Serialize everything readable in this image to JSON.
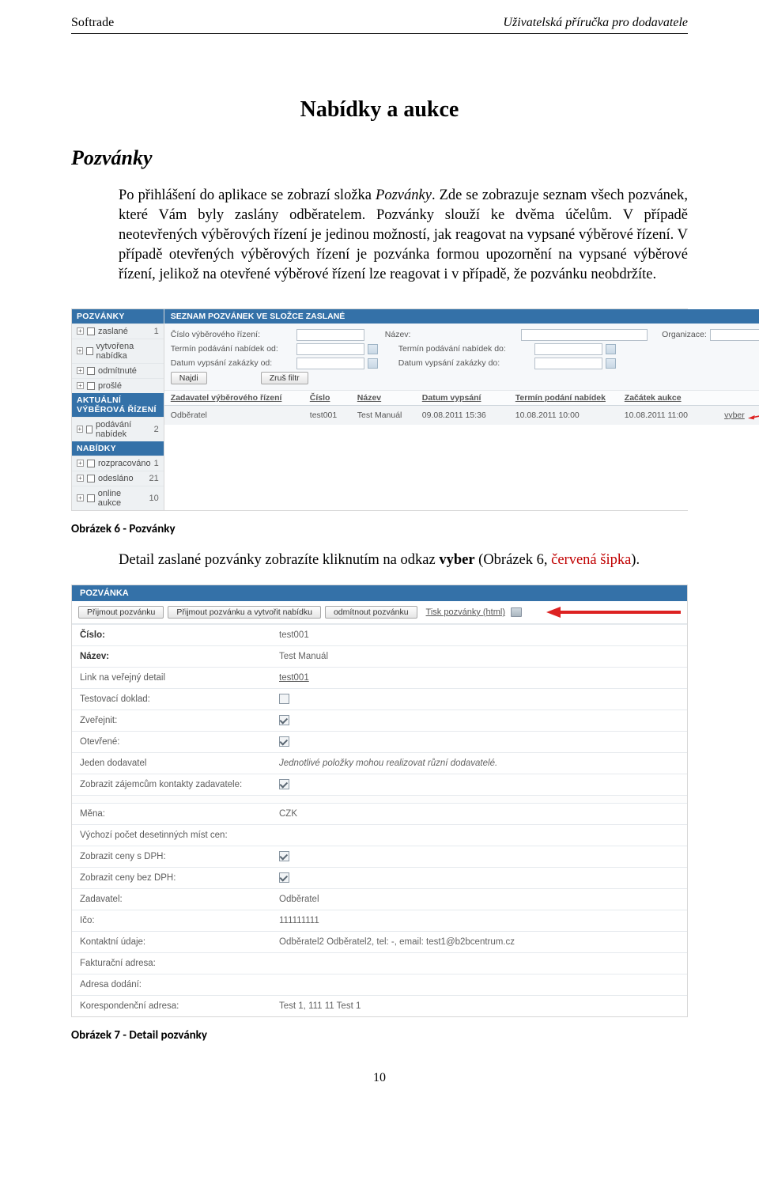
{
  "header": {
    "left": "Softrade",
    "right": "Uživatelská příručka pro dodavatele"
  },
  "h1": "Nabídky a aukce",
  "h2": "Pozvánky",
  "para1_parts": {
    "a": "Po přihlášení do aplikace se zobrazí složka ",
    "b": "Pozvánky",
    "c": ". Zde se zobrazuje seznam všech pozvánek, které Vám byly zaslány odběratelem. Pozvánky slouží ke dvěma účelům. V případě neotevřených výběrových řízení je jedinou možností, jak reagovat na vypsané výběrové řízení. V případě otevřených výběrových řízení je pozvánka formou upozornění na vypsané výběrové řízení, jelikož na otevřené výběrové řízení lze reagovat i v případě, že pozvánku neobdržíte."
  },
  "caption1": "Obrázek 6 - Pozvánky",
  "para2_parts": {
    "a": "Detail zaslané pozvánky zobrazíte kliknutím na odkaz ",
    "b": "vyber",
    "c": " (Obrázek 6, ",
    "d": "červená šipka",
    "e": ")."
  },
  "caption2": "Obrázek 7 - Detail pozvánky",
  "page_num": "10",
  "shot1": {
    "side": {
      "sec1": "POZVÁNKY",
      "items1": [
        {
          "label": "zaslané",
          "count": "1"
        },
        {
          "label": "vytvořena nabídka",
          "count": ""
        },
        {
          "label": "odmítnuté",
          "count": ""
        },
        {
          "label": "prošlé",
          "count": ""
        }
      ],
      "sec2": "AKTUÁLNÍ VÝBĚROVÁ ŘÍZENÍ",
      "items2": [
        {
          "label": "podávání nabídek",
          "count": "2"
        }
      ],
      "sec3": "NABÍDKY",
      "items3": [
        {
          "label": "rozpracováno",
          "count": "1"
        },
        {
          "label": "odesláno",
          "count": "21"
        },
        {
          "label": "online aukce",
          "count": "10"
        }
      ]
    },
    "main": {
      "sec": "SEZNAM POZVÁNEK VE SLOŽCE ZASLANÉ",
      "filter": {
        "r1": {
          "l1": "Číslo výběrového řízení:",
          "l2": "Název:",
          "l3": "Organizace:"
        },
        "r2": {
          "l1": "Termín podávání nabídek od:",
          "l2": "Termín podávání nabídek do:"
        },
        "r3": {
          "l1": "Datum vypsání zakázky od:",
          "l2": "Datum vypsání zakázky do:"
        },
        "btn_find": "Najdi",
        "btn_clear": "Zruš filtr"
      },
      "th": {
        "c1": "Zadavatel výběrového řízení",
        "c2": "Číslo",
        "c3": "Název",
        "c4": "Datum vypsání",
        "c5": "Termín podání nabídek",
        "c6": "Začátek aukce",
        "c7": ""
      },
      "row": {
        "c1": "Odběratel",
        "c2": "test001",
        "c3": "Test Manuál",
        "c4": "09.08.2011 15:36",
        "c5": "10.08.2011 10:00",
        "c6": "10.08.2011 11:00",
        "c7": "vyber"
      }
    }
  },
  "shot2": {
    "bar": "POZVÁNKA",
    "buttons": {
      "accept": "Přijmout pozvánku",
      "accept_create": "Přijmout pozvánku a vytvořit nabídku",
      "reject": "odmítnout pozvánku",
      "print": "Tisk pozvánky (html)"
    },
    "rows": [
      {
        "k": "Číslo:",
        "v": "test001",
        "strong": true,
        "type": "text"
      },
      {
        "k": "Název:",
        "v": "Test Manuál",
        "strong": true,
        "type": "text"
      },
      {
        "k": "Link na veřejný detail",
        "v": "test001",
        "strong": false,
        "type": "link"
      },
      {
        "k": "Testovací doklad:",
        "v": "",
        "strong": false,
        "type": "check_off"
      },
      {
        "k": "Zveřejnit:",
        "v": "",
        "strong": false,
        "type": "check_on"
      },
      {
        "k": "Otevřené:",
        "v": "",
        "strong": false,
        "type": "check_on"
      },
      {
        "k": "Jeden dodavatel",
        "v": "Jednotlivé položky mohou realizovat různí dodavatelé.",
        "strong": false,
        "type": "italic"
      },
      {
        "k": "Zobrazit zájemcům kontakty zadavatele:",
        "v": "",
        "strong": false,
        "type": "check_on"
      }
    ],
    "rows2": [
      {
        "k": "Měna:",
        "v": "CZK",
        "strong": false,
        "type": "text"
      },
      {
        "k": "Výchozí počet desetinných míst cen:",
        "v": "",
        "strong": false,
        "type": "text"
      },
      {
        "k": "Zobrazit ceny s DPH:",
        "v": "",
        "strong": false,
        "type": "check_on"
      },
      {
        "k": "Zobrazit ceny bez DPH:",
        "v": "",
        "strong": false,
        "type": "check_on"
      },
      {
        "k": "Zadavatel:",
        "v": "Odběratel",
        "strong": false,
        "type": "text"
      },
      {
        "k": "Ičo:",
        "v": "111111111",
        "strong": false,
        "type": "text"
      },
      {
        "k": "Kontaktní údaje:",
        "v": "Odběratel2 Odběratel2, tel: -, email: test1@b2bcentrum.cz",
        "strong": false,
        "type": "text"
      },
      {
        "k": "Fakturační adresa:",
        "v": "",
        "strong": false,
        "type": "text"
      },
      {
        "k": "Adresa dodání:",
        "v": "",
        "strong": false,
        "type": "text"
      },
      {
        "k": "Korespondenční adresa:",
        "v": "Test 1, 111 11 Test 1",
        "strong": false,
        "type": "text"
      }
    ]
  }
}
